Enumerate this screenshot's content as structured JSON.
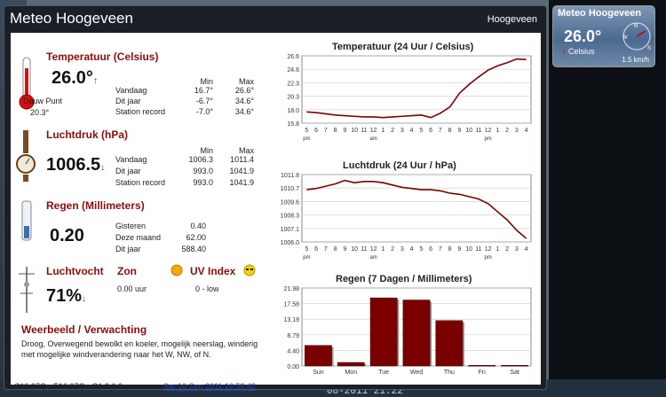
{
  "window": {
    "title": "Meteo Hoogeveen",
    "location": "Hoogeveen"
  },
  "temperature": {
    "heading": "Temperatuur (Celsius)",
    "current": "26.0°",
    "trend": "↑",
    "dew_label": "Dauw Punt",
    "dew_value": "20.3°",
    "col_min": "Min",
    "col_max": "Max",
    "rows": [
      {
        "label": "Vandaag",
        "min": "16.7°",
        "max": "26.6°"
      },
      {
        "label": "Dit jaar",
        "min": "-6.7°",
        "max": "34.6°"
      },
      {
        "label": "Station record",
        "min": "-7.0°",
        "max": "34.6°"
      }
    ]
  },
  "pressure": {
    "heading": "Luchtdruk (hPa)",
    "current": "1006.5",
    "trend": "↓",
    "col_min": "Min",
    "col_max": "Max",
    "rows": [
      {
        "label": "Vandaag",
        "min": "1006.3",
        "max": "1011.4"
      },
      {
        "label": "Dit jaar",
        "min": "993.0",
        "max": "1041.9"
      },
      {
        "label": "Station record",
        "min": "993.0",
        "max": "1041.9"
      }
    ]
  },
  "rain": {
    "heading": "Regen (Millimeters)",
    "current": "0.20",
    "rows": [
      {
        "label": "Gisteren",
        "value": "0.40"
      },
      {
        "label": "Deze maand",
        "value": "62.00"
      },
      {
        "label": "Dit jaar",
        "value": "588.40"
      }
    ]
  },
  "humidity": {
    "heading": "Luchtvocht",
    "current": "71%",
    "trend": "↓"
  },
  "sun": {
    "heading": "Zon",
    "value": "0.00 uur"
  },
  "uv": {
    "heading": "UV Index",
    "value": "0 - low"
  },
  "forecast": {
    "heading": "Weerbeeld / Verwachting",
    "text": "Droog, Overwegend bewolkt en koeler, mogelijk neerslag, winderig met mogelijke windverandering naar het W, NW, of N."
  },
  "footer": {
    "version": "C10.37Q - E10.37Q - G1.8.0.0",
    "date_link": "Sat 10 Sep 2011 16:58:42"
  },
  "gadget": {
    "title": "Meteo Hoogeveen",
    "temp": "26.0°",
    "unit": "Celsius",
    "wind": "1.5 km/h"
  },
  "background": {
    "taskbar_time": "08-2011 21:22"
  },
  "colors": {
    "accent": "#8a0d0d",
    "line": "#7a0000",
    "bar": "#7a0000"
  },
  "chart_data": [
    {
      "type": "line",
      "title": "Temperatuur (24 Uur / Celsius)",
      "x": [
        "5",
        "6",
        "7",
        "8",
        "9",
        "10",
        "11",
        "12",
        "1",
        "2",
        "3",
        "4",
        "5",
        "6",
        "7",
        "8",
        "9",
        "10",
        "11",
        "12",
        "1",
        "2",
        "3",
        "4"
      ],
      "x_sub": [
        "pm",
        "",
        "",
        "",
        "",
        "",
        "",
        "am",
        "",
        "",
        "",
        "",
        "",
        "",
        "",
        "",
        "",
        "",
        "",
        "pm",
        "",
        "",
        "",
        ""
      ],
      "yticks": [
        "26.6",
        "24.6",
        "22.3",
        "20.3",
        "18.0",
        "15.8"
      ],
      "ylim": [
        15.8,
        26.6
      ],
      "series": [
        {
          "values": [
            17.6,
            17.5,
            17.3,
            17.1,
            17.0,
            16.9,
            16.8,
            16.8,
            16.7,
            16.8,
            16.9,
            17.0,
            17.1,
            16.7,
            17.4,
            18.4,
            20.6,
            22.0,
            23.2,
            24.3,
            25.0,
            25.5,
            26.1,
            26.0
          ]
        }
      ]
    },
    {
      "type": "line",
      "title": "Luchtdruk (24 Uur / hPa)",
      "x": [
        "5",
        "6",
        "7",
        "8",
        "9",
        "10",
        "11",
        "12",
        "1",
        "2",
        "3",
        "4",
        "5",
        "6",
        "7",
        "8",
        "9",
        "10",
        "11",
        "12",
        "1",
        "2",
        "3",
        "4"
      ],
      "x_sub": [
        "pm",
        "",
        "",
        "",
        "",
        "",
        "",
        "am",
        "",
        "",
        "",
        "",
        "",
        "",
        "",
        "",
        "",
        "",
        "",
        "pm",
        "",
        "",
        "",
        ""
      ],
      "yticks": [
        "1011.8",
        "1010.7",
        "1009.6",
        "1008.3",
        "1007.1",
        "1006.0"
      ],
      "ylim": [
        1006.0,
        1011.8
      ],
      "series": [
        {
          "values": [
            1010.5,
            1010.6,
            1010.8,
            1011.0,
            1011.3,
            1011.1,
            1011.2,
            1011.2,
            1011.1,
            1010.9,
            1010.7,
            1010.6,
            1010.5,
            1010.5,
            1010.4,
            1010.2,
            1010.1,
            1009.9,
            1009.7,
            1009.3,
            1008.6,
            1007.9,
            1007.0,
            1006.3
          ]
        }
      ]
    },
    {
      "type": "bar",
      "title": "Regen (7 Dagen / Millimeters)",
      "categories": [
        "Sun",
        "Mon",
        "Tue",
        "Wed",
        "Thu",
        "Fri",
        "Sat"
      ],
      "yticks": [
        "21.98",
        "17.58",
        "13.19",
        "8.79",
        "4.40",
        "0.00"
      ],
      "ylim": [
        0,
        21.98
      ],
      "values": [
        5.8,
        1.0,
        19.2,
        18.6,
        12.8,
        0.2,
        0.2
      ]
    }
  ]
}
